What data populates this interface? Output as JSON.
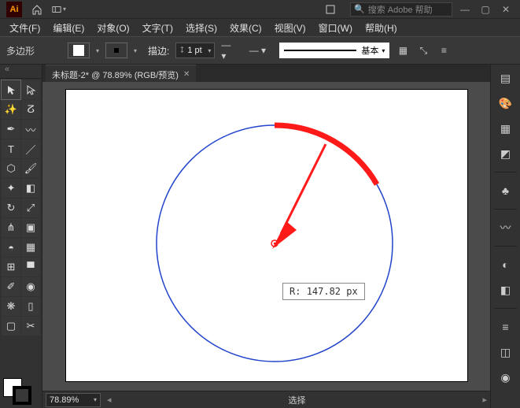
{
  "topbar": {
    "app_initials": "Ai",
    "search_placeholder": "搜索 Adobe 帮助"
  },
  "menubar": {
    "file": "文件(F)",
    "edit": "编辑(E)",
    "object": "对象(O)",
    "type": "文字(T)",
    "select": "选择(S)",
    "effect": "效果(C)",
    "view": "视图(V)",
    "window": "窗口(W)",
    "help": "帮助(H)"
  },
  "optbar": {
    "tool_label": "多边形",
    "stroke_label": "描边:",
    "stroke_value": "1 pt",
    "style_value": "基本"
  },
  "tab": {
    "title": "未标题-2* @ 78.89% (RGB/预览)"
  },
  "canvas": {
    "radius_label": "R:",
    "radius_value": "147.82 px"
  },
  "statusbar": {
    "zoom": "78.89%",
    "mode": "选择"
  },
  "icons": {
    "home": "⌂",
    "layout": "▥",
    "expand": "⛶",
    "search": "🔍",
    "min": "—",
    "max": "▢",
    "close": "✕",
    "chev_down": "▾",
    "props": "☰",
    "layers": "▤",
    "more": "⋯"
  }
}
